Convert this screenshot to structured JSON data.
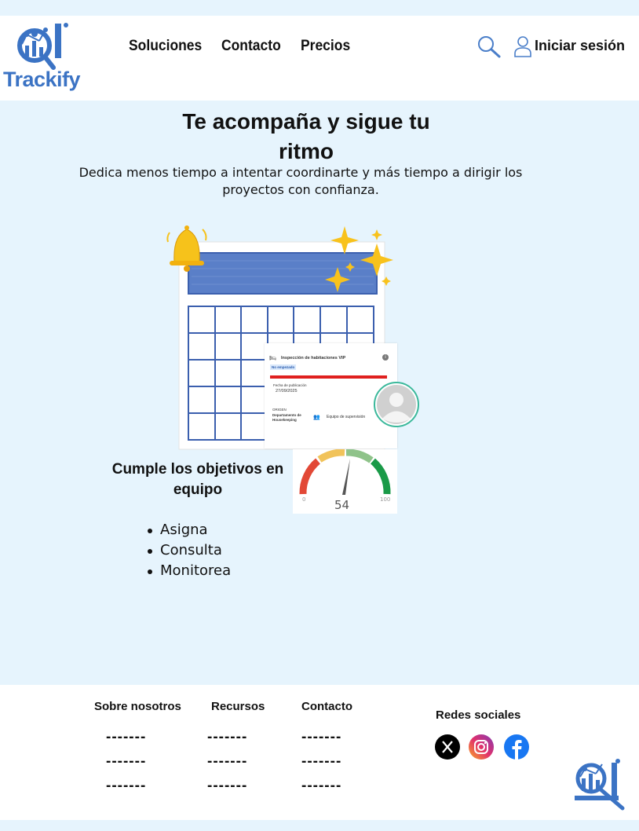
{
  "brand": {
    "name": "Trackify"
  },
  "nav": {
    "items": [
      {
        "label": "Soluciones"
      },
      {
        "label": "Contacto"
      },
      {
        "label": "Precios"
      }
    ],
    "login": "Iniciar sesión"
  },
  "hero": {
    "title": "Te acompaña y sigue tu ritmo",
    "subtitle": "Dedica menos tiempo a intentar coordinarte y más tiempo a dirigir los proyectos con confianza."
  },
  "card": {
    "title": "Inspección de habitaciones VIP",
    "status": "No empezado",
    "date_label": "Fecha de publicación",
    "date": "27/09/2025",
    "origin_label": "ORIGEN",
    "origin": "Departamento de Housekeeping",
    "team": "Equipo de supervisión"
  },
  "gauge": {
    "min": "0",
    "max": "100",
    "value": "54",
    "fraction": 0.54
  },
  "feature": {
    "title": "Cumple los objetivos en equipo",
    "items": [
      "Asigna",
      "Consulta",
      "Monitorea"
    ]
  },
  "footer": {
    "columns": [
      {
        "title": "Sobre nosotros",
        "links": [
          "-------",
          "-------",
          "-------"
        ]
      },
      {
        "title": "Recursos",
        "links": [
          "-------",
          "-------",
          "-------"
        ]
      },
      {
        "title": "Contacto",
        "links": [
          "-------",
          "-------",
          "-------"
        ]
      }
    ],
    "social_title": "Redes sociales"
  },
  "social": [
    {
      "icon": "x-icon"
    },
    {
      "icon": "instagram-icon"
    },
    {
      "icon": "facebook-icon"
    }
  ],
  "colors": {
    "brand": "#3b73c4",
    "background": "#e6f4fd",
    "accent_green": "#3bb89b"
  }
}
